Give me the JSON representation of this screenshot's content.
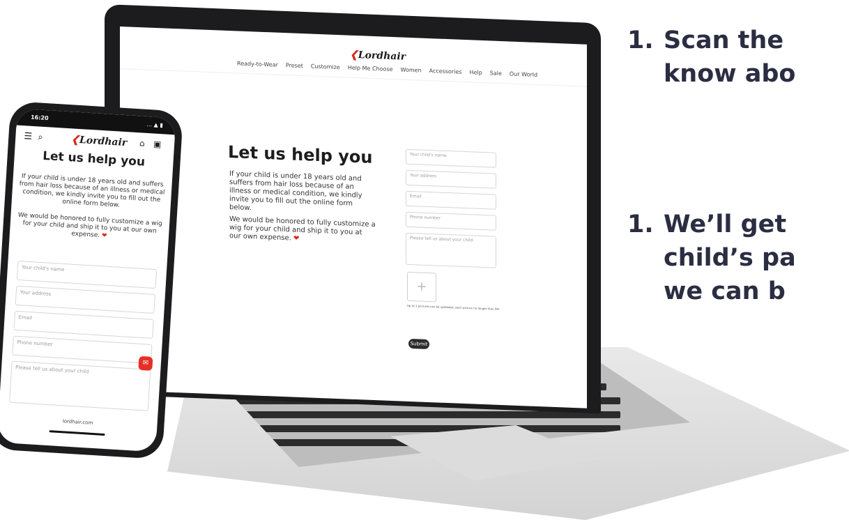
{
  "steps": [
    {
      "number": "1.",
      "line1": "Scan the",
      "line2": "know abo"
    },
    {
      "number": "1.",
      "line1": "We’ll get",
      "line2": "child’s pa",
      "line3": "we can b"
    }
  ],
  "brand": {
    "logo_text": "Lordhair",
    "logo_mark": "❮",
    "accent_color": "#d62b1f"
  },
  "desktop": {
    "nav": [
      "Ready-to-Wear",
      "Preset",
      "Customize",
      "Help Me Choose",
      "Women",
      "Accessories",
      "Help",
      "Sale",
      "Our World"
    ],
    "title": "Let us help you",
    "para1": "If your child is under 18 years old and suffers from hair loss because of an illness or medical condition, we kindly invite you to fill out the online form below.",
    "para2": "We would be honored to fully customize a wig for your child and ship it to you at our own expense.",
    "heart": "❤",
    "form": {
      "child_name": "Your child's name",
      "address": "Your address",
      "email": "Email",
      "phone": "Phone number",
      "about": "Please tell us about your child",
      "upload_plus": "+",
      "upload_note": "Up to 3 pictures can be uploaded, each picture no longer than 5M",
      "submit": "Submit"
    }
  },
  "mobile": {
    "time": "16:20",
    "status_icons": "… ▲ ▮",
    "title": "Let us help you",
    "para1": "If your child is under 18 years old and suffers from hair loss because of an illness or medical condition, we kindly invite you to fill out the online form below.",
    "para2": "We would be honored to fully customize a wig for your child and ship it to you at our own expense.",
    "heart": "❤",
    "form": {
      "child_name": "Your child's name",
      "address": "Your address",
      "email": "Email",
      "phone": "Phone number",
      "about": "Please tell us about your child"
    },
    "url": "lordhair.com",
    "menu_icon": "☰",
    "search_icon": "⌕",
    "user_icon": "⌂",
    "cart_icon": "▣",
    "chat_icon": "✉"
  }
}
